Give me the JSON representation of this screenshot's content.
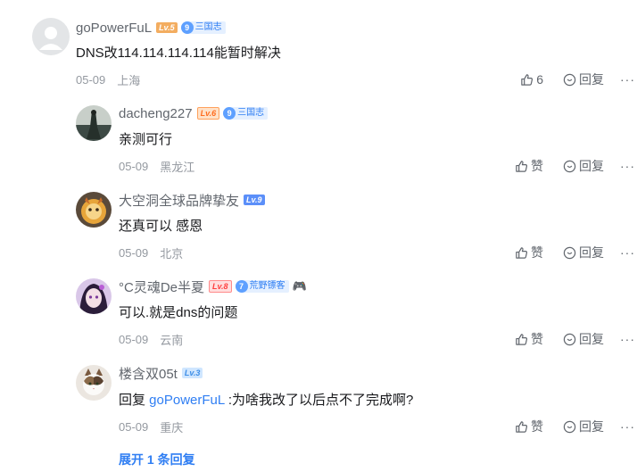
{
  "comments": [
    {
      "username": "goPowerFuL",
      "level": "Lv.5",
      "medal": {
        "level": "9",
        "name": "三国志"
      },
      "text": "DNS改114.114.114.114能暂时解决",
      "date": "05-09",
      "location": "上海",
      "like_label": "6",
      "reply_label": "回复",
      "more": "···"
    },
    {
      "username": "dacheng227",
      "level": "Lv.6",
      "medal": {
        "level": "9",
        "name": "三国志"
      },
      "text": "亲测可行",
      "date": "05-09",
      "location": "黑龙江",
      "like_label": "赞",
      "reply_label": "回复",
      "more": "···"
    },
    {
      "username": "大空洞全球品牌挚友",
      "level": "Lv.9",
      "text": "还真可以 感恩",
      "date": "05-09",
      "location": "北京",
      "like_label": "赞",
      "reply_label": "回复",
      "more": "···"
    },
    {
      "username": "°C灵魂De半夏",
      "level": "Lv.8",
      "medal": {
        "level": "7",
        "name": "荒野镖客"
      },
      "badge_emoji": "🎮",
      "text": "可以.就是dns的问题",
      "date": "05-09",
      "location": "云南",
      "like_label": "赞",
      "reply_label": "回复",
      "more": "···"
    },
    {
      "username": "楼含双05t",
      "level": "Lv.3",
      "text_prefix": "回复 ",
      "text_mention": "goPowerFuL",
      "text": " :为啥我改了以后点不了完成啊?",
      "date": "05-09",
      "location": "重庆",
      "like_label": "赞",
      "reply_label": "回复",
      "more": "···"
    }
  ],
  "expand_label": "展开 1 条回复",
  "colors": {
    "link": "#2f7ef3",
    "meta": "#9499a0",
    "text": "#18191c"
  }
}
